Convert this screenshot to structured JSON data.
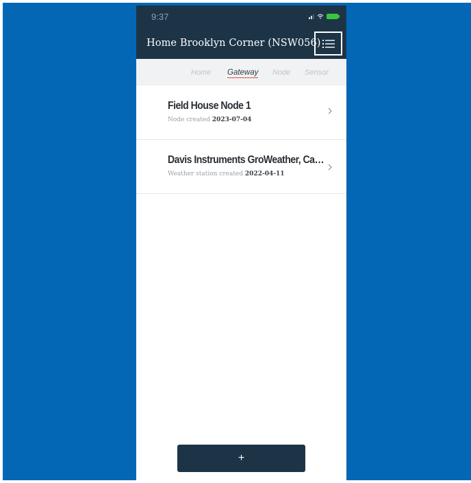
{
  "status_bar": {
    "time": "9:37"
  },
  "header": {
    "title": "Home  Brooklyn Corner (NSW056)",
    "menu_icon": "list-icon"
  },
  "tabs": [
    {
      "label": "Home",
      "active": false
    },
    {
      "label": "Gateway",
      "active": true
    },
    {
      "label": "Node",
      "active": false
    },
    {
      "label": "Sensor",
      "active": false
    }
  ],
  "items": [
    {
      "title": "Field House Node 1",
      "subtitle_prefix": "Node created",
      "date": "2023-07-04"
    },
    {
      "title": "Davis Instruments GroWeather, Cabl...",
      "subtitle_prefix": "Weather station created",
      "date": "2022-04-11"
    }
  ],
  "add_button": {
    "label": "+"
  },
  "colors": {
    "background": "#0467b5",
    "header": "#1d3447",
    "tab_active_underline": "#e0533c",
    "battery": "#39c53e"
  }
}
